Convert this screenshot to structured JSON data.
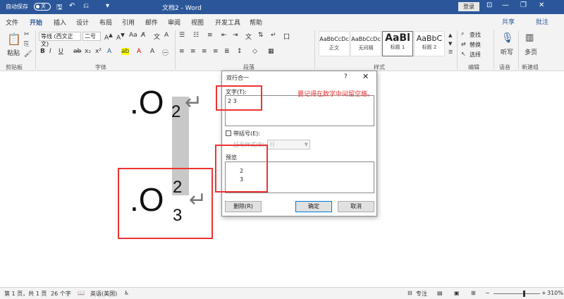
{
  "titlebar": {
    "autosave_label": "自动保存",
    "autosave_state": "关",
    "doc_title": "文档2  -  Word",
    "login_label": "登录"
  },
  "tabs": [
    "文件",
    "开始",
    "插入",
    "设计",
    "布局",
    "引用",
    "邮件",
    "审阅",
    "视图",
    "开发工具",
    "帮助"
  ],
  "active_tab": "开始",
  "share_label": "共享",
  "comment_label": "批注",
  "ribbon": {
    "clipboard": {
      "paste": "粘贴",
      "label": "剪贴板"
    },
    "font": {
      "name": "等线 (西文正文)",
      "size": "二号",
      "label": "字体"
    },
    "paragraph": {
      "label": "段落"
    },
    "styles": {
      "label": "样式",
      "items": [
        {
          "sample": "AaBbCcDc",
          "name": "正文"
        },
        {
          "sample": "AaBbCcDc",
          "name": "无间隔"
        },
        {
          "sample": "AaBl",
          "name": "标题 1"
        },
        {
          "sample": "AaBbC",
          "name": "标题 2"
        }
      ]
    },
    "editing": {
      "find": "查找",
      "replace": "替换",
      "select": "选择",
      "label": "编辑"
    },
    "voice": {
      "dictate": "听写",
      "label": "语音"
    },
    "new_group": {
      "multipage": "多页",
      "label": "新建组"
    }
  },
  "document": {
    "line1": {
      "main": ".O",
      "sub": "2"
    },
    "line2": {
      "main": ".O",
      "sup": "2",
      "sub": "3"
    },
    "annotation": "要记得在数字中间留空格。"
  },
  "dialog": {
    "title": "双行合一",
    "help": "?",
    "text_label": "文字(T):",
    "text_value": "2 3",
    "bracket_label": "带括号(E):",
    "bracket_style_label": "括号样式(B):",
    "bracket_style_value": "()",
    "preview_label": "预览",
    "preview_line1": "2",
    "preview_line2": "3",
    "delete_label": "删除(R)",
    "ok_label": "确定",
    "cancel_label": "取消"
  },
  "statusbar": {
    "page": "第 1 页，共 1 页",
    "words": "26 个字",
    "language": "英语(美国)",
    "focus": "专注",
    "zoom": "310%"
  },
  "colors": {
    "word_blue": "#2b579a",
    "annotation_red": "#ee3333"
  }
}
